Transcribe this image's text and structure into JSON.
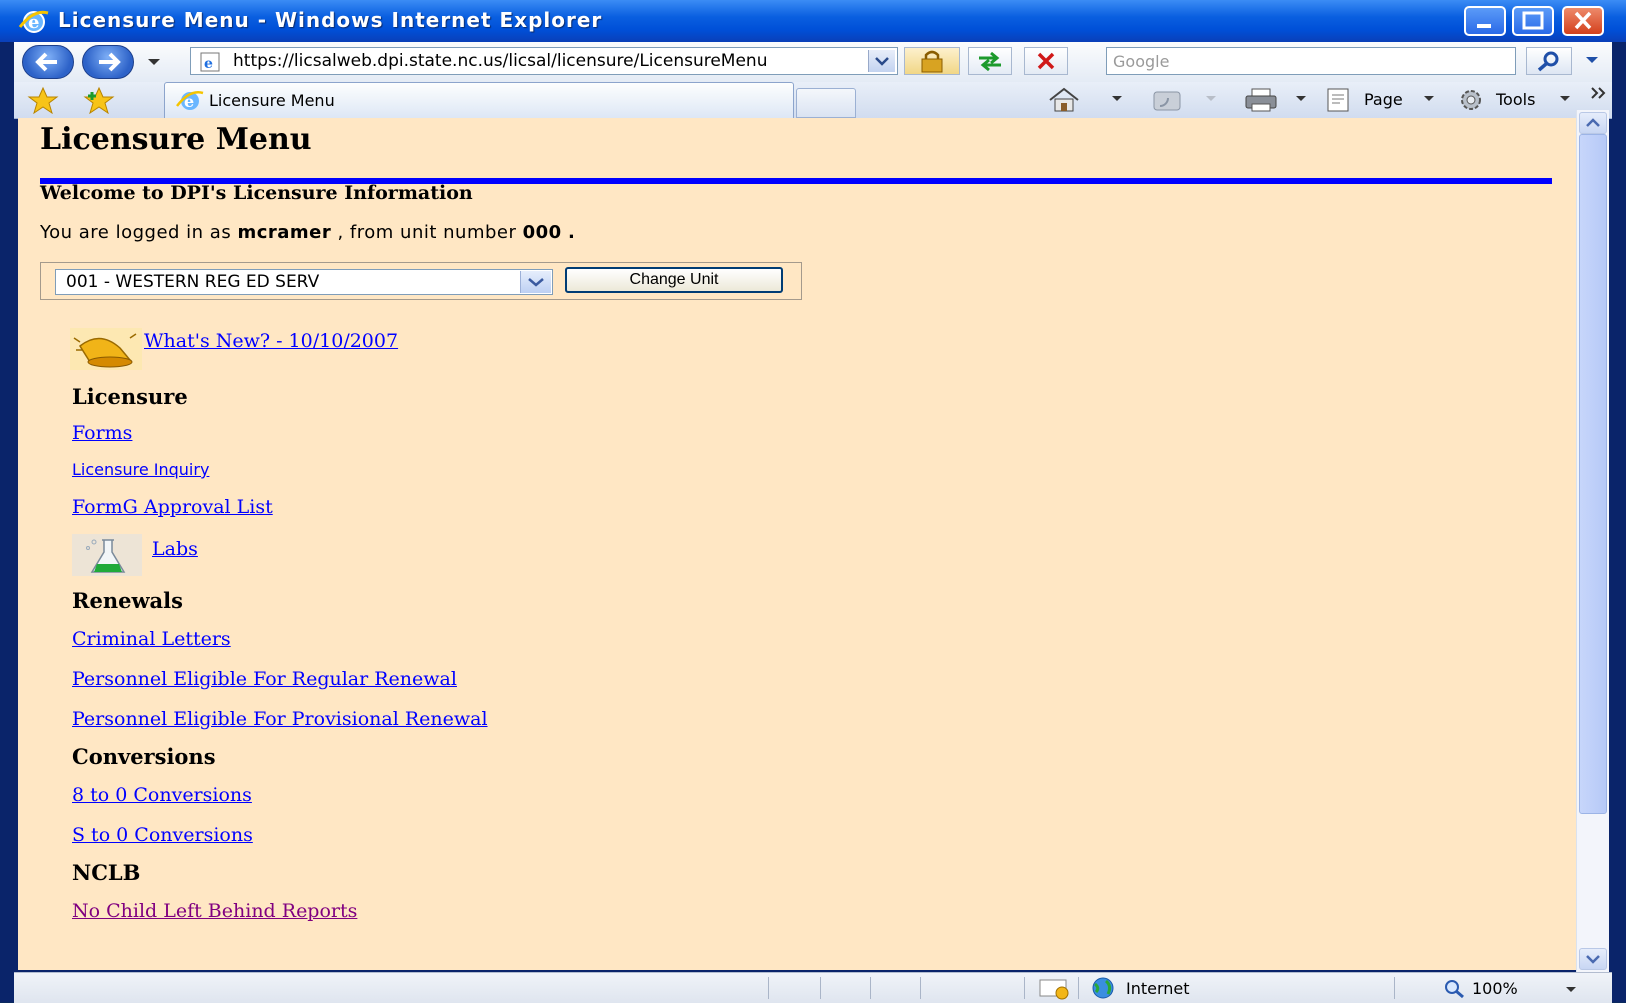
{
  "window": {
    "title": "Licensure Menu - Windows Internet Explorer",
    "url": "https://licsalweb.dpi.state.nc.us/licsal/licensure/LicensureMenu",
    "search_placeholder": "Google",
    "tab_label": "Licensure Menu",
    "toolbar": {
      "page_label": "Page",
      "tools_label": "Tools"
    },
    "status": {
      "zone": "Internet",
      "zoom": "100%"
    }
  },
  "page": {
    "title": "Licensure Menu",
    "welcome": "Welcome to DPI's Licensure Information",
    "logged_prefix": "You are logged in as",
    "username": "mcramer",
    "logged_mid": ", from unit number",
    "unit_number": "000",
    "logged_end": ".",
    "unit_select_value": "001 - WESTERN REG ED SERV",
    "change_unit_label": "Change Unit",
    "whats_new": "What's New? - 10/10/2007",
    "sections": {
      "licensure": {
        "heading": "Licensure",
        "links": [
          "Forms",
          "Licensure Inquiry",
          "FormG Approval List"
        ],
        "labs": "Labs"
      },
      "renewals": {
        "heading": "Renewals",
        "links": [
          "Criminal Letters",
          "Personnel Eligible For Regular Renewal",
          "Personnel Eligible For Provisional Renewal"
        ]
      },
      "conversions": {
        "heading": "Conversions",
        "links": [
          "8 to 0 Conversions",
          "S to 0 Conversions"
        ]
      },
      "nclb": {
        "heading": "NCLB",
        "links": [
          "No Child Left Behind Reports"
        ]
      }
    }
  },
  "icons": [
    "ie-logo-icon",
    "back-icon",
    "forward-icon",
    "lock-icon",
    "refresh-icon",
    "stop-icon",
    "search-icon",
    "favorites-star-icon",
    "add-favorites-icon",
    "home-icon",
    "feeds-icon",
    "print-icon",
    "page-icon",
    "tools-gear-icon",
    "bell-icon",
    "flask-icon",
    "globe-icon",
    "zoom-icon"
  ],
  "colors": {
    "page_bg": "#ffe7c4",
    "link": "#0000ff",
    "visited_link": "#800080",
    "rule": "#0000ff"
  }
}
